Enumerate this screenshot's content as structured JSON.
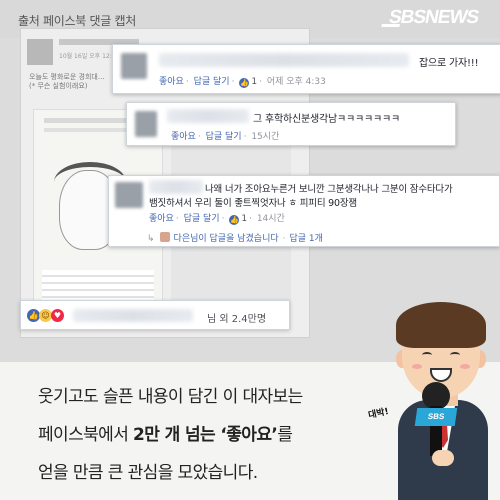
{
  "header": {
    "source_label": "출처 페이스북 댓글 캡처",
    "brand": "SBSNEWS"
  },
  "background_post": {
    "date_line": "10월 16일 오후 12:16",
    "text_line1": "오늘도 평화로운 경희대...",
    "text_line2": "(* 무슨 실험이래요)"
  },
  "comments": [
    {
      "text": "잡으로 가자!!!",
      "like": "좋아요",
      "reply": "답글 달기",
      "likes_count": "1",
      "time": "어제 오후 4:33"
    },
    {
      "text": "그 후학하신분생각남ㅋㅋㅋㅋㅋㅋㅋ",
      "like": "좋아요",
      "reply": "답글 달기",
      "time": "15시간"
    },
    {
      "text_line1": "나왜 너가 조아요누른거 보니깐 그분생각나나 그분이 잠수타다가",
      "text_line2": "뱀짓하셔서 우리 둘이 좋트찍엇자나 ㅎ 피피티 90장잼",
      "like": "좋아요",
      "reply": "답글 달기",
      "likes_count": "1",
      "time": "14시간",
      "reply_row": {
        "text": "다은님이 답글을 남겼습니다",
        "reply_count": "답글 1개"
      }
    }
  ],
  "reactions": {
    "summary": "님 외 2.4만명"
  },
  "caption": {
    "line1": "웃기고도 슬픈 내용이 담긴 이 대자보는",
    "line2_pre": "페이스북에서 ",
    "line2_bold": "2만 개 넘는 ‘좋아요’",
    "line2_post": "를",
    "line3": "얻을 만큼 큰 관심을 모았습니다."
  },
  "character": {
    "exclamation": "대박!",
    "mic_label": "SBS"
  },
  "colors": {
    "facebook_blue": "#4267b2",
    "caption_bg": "#f4f4f2",
    "page_bg": "#dcdcdc"
  }
}
